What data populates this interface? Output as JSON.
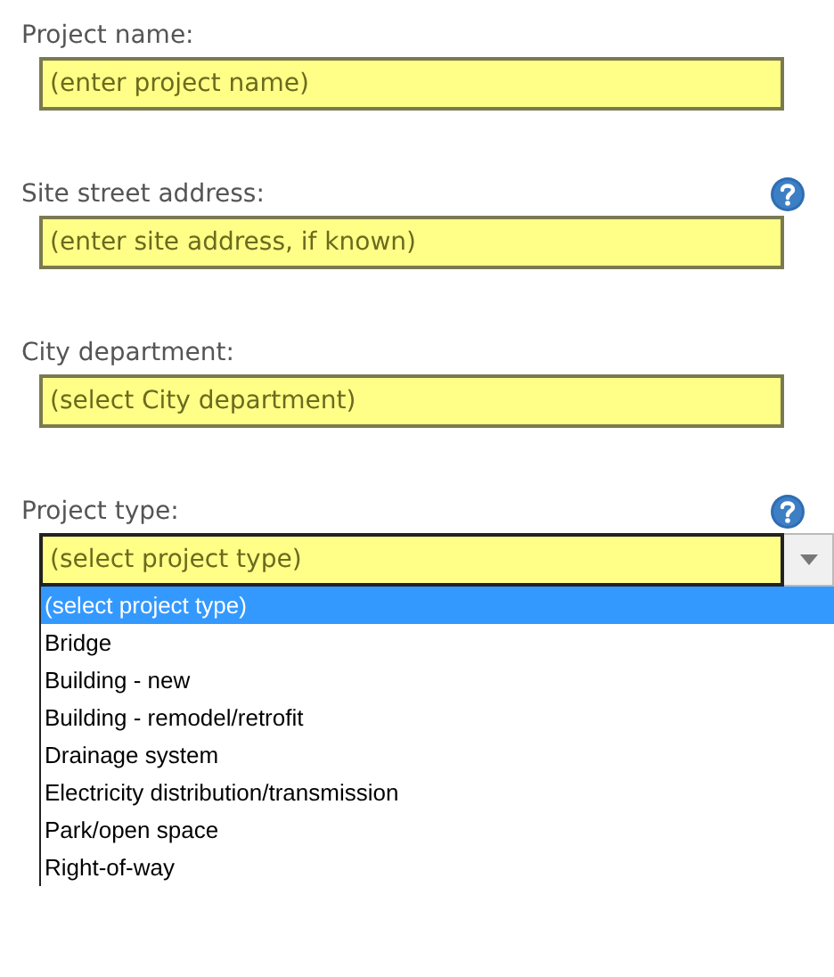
{
  "fields": [
    {
      "kind": "text",
      "label": "Project name:",
      "help": false,
      "placeholder": "(enter project name)"
    },
    {
      "kind": "text",
      "label": "Site street address:",
      "help": true,
      "placeholder": "(enter site address, if known)"
    },
    {
      "kind": "dropdown",
      "label": "City department:",
      "help": false,
      "value": "(select City department)",
      "expanded": false
    },
    {
      "kind": "dropdown",
      "label": "Project type:",
      "help": true,
      "value": "(select project type)",
      "expanded": true,
      "options": [
        {
          "label": "(select project type)",
          "selected": true
        },
        {
          "label": "Bridge",
          "selected": false
        },
        {
          "label": "Building - new",
          "selected": false
        },
        {
          "label": "Building - remodel/retrofit",
          "selected": false
        },
        {
          "label": "Drainage system",
          "selected": false
        },
        {
          "label": "Electricity distribution/transmission",
          "selected": false
        },
        {
          "label": "Park/open space",
          "selected": false
        },
        {
          "label": "Right-of-way",
          "selected": false
        }
      ]
    }
  ]
}
